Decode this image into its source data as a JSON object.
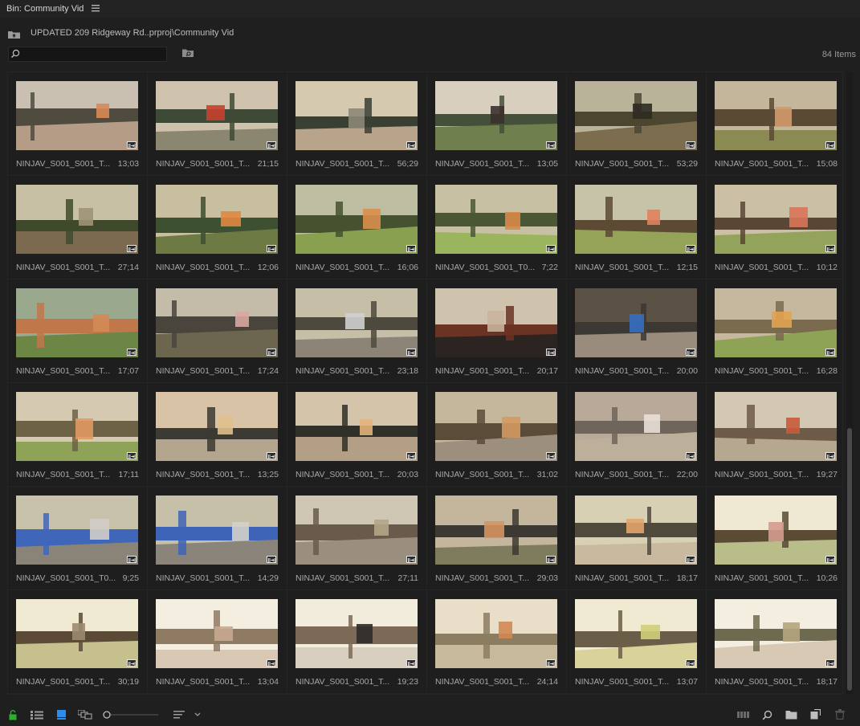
{
  "panel": {
    "title": "Bin: Community Vid"
  },
  "path": {
    "text": "UPDATED 209 Ridgeway Rd..prproj\\Community Vid"
  },
  "search": {
    "value": "",
    "placeholder": ""
  },
  "status": {
    "items_count": "84 Items"
  },
  "clips": [
    {
      "name": "NINJAV_S001_S001_T...",
      "duration": "13;03",
      "palette": {
        "sky": "#c9c0b2",
        "mid": "#4f4b3f",
        "ground": "#b59c86",
        "accent": "#d88a55"
      }
    },
    {
      "name": "NINJAV_S001_S001_T...",
      "duration": "21;15",
      "palette": {
        "sky": "#cfc2ad",
        "mid": "#3f4a36",
        "ground": "#8a8670",
        "accent": "#c7402c"
      }
    },
    {
      "name": "NINJAV_S001_S001_T...",
      "duration": "56;29",
      "palette": {
        "sky": "#d5c9b0",
        "mid": "#3a3f33",
        "ground": "#b8a48a",
        "accent": "#8d8777"
      }
    },
    {
      "name": "NINJAV_S001_S001_T...",
      "duration": "13;05",
      "palette": {
        "sky": "#d9cfbf",
        "mid": "#45503a",
        "ground": "#6f7f4d",
        "accent": "#3b302c"
      }
    },
    {
      "name": "NINJAV_S001_S001_T...",
      "duration": "53;29",
      "palette": {
        "sky": "#b9b39a",
        "mid": "#4c4631",
        "ground": "#7c6d4f",
        "accent": "#2e2a22"
      }
    },
    {
      "name": "NINJAV_S001_S001_T...",
      "duration": "15;08",
      "palette": {
        "sky": "#c4b69a",
        "mid": "#5a4a35",
        "ground": "#8c8a53",
        "accent": "#d39a6a"
      }
    },
    {
      "name": "NINJAV_S001_S001_T...",
      "duration": "27;14",
      "palette": {
        "sky": "#c7c0a4",
        "mid": "#3f4a2d",
        "ground": "#7c6a50",
        "accent": "#a09475"
      }
    },
    {
      "name": "NINJAV_S001_S001_T...",
      "duration": "12;06",
      "palette": {
        "sky": "#c8bea0",
        "mid": "#3d5030",
        "ground": "#6e7a44",
        "accent": "#e08840"
      }
    },
    {
      "name": "NINJAV_S001_S001_T...",
      "duration": "16;06",
      "palette": {
        "sky": "#bdbda2",
        "mid": "#45512f",
        "ground": "#88a050",
        "accent": "#d98f4c"
      }
    },
    {
      "name": "NINJAV_S001_S001_T0...",
      "duration": "7;22",
      "palette": {
        "sky": "#c8c0a2",
        "mid": "#4a5734",
        "ground": "#9bb55e",
        "accent": "#d78a48"
      }
    },
    {
      "name": "NINJAV_S001_S001_T...",
      "duration": "12;15",
      "palette": {
        "sky": "#c7c3a8",
        "mid": "#5c4a34",
        "ground": "#95a359",
        "accent": "#e0825e"
      }
    },
    {
      "name": "NINJAV_S001_S001_T...",
      "duration": "10;12",
      "palette": {
        "sky": "#cbbfa6",
        "mid": "#5a4634",
        "ground": "#93a35b",
        "accent": "#d9755a"
      }
    },
    {
      "name": "NINJAV_S001_S001_T...",
      "duration": "17;07",
      "palette": {
        "sky": "#9aa98d",
        "mid": "#c0784a",
        "ground": "#6c8646",
        "accent": "#d48a57"
      }
    },
    {
      "name": "NINJAV_S001_S001_T...",
      "duration": "17;24",
      "palette": {
        "sky": "#c4bca8",
        "mid": "#4a453c",
        "ground": "#6c664f",
        "accent": "#d8a6a0"
      }
    },
    {
      "name": "NINJAV_S001_S001_T...",
      "duration": "23;18",
      "palette": {
        "sky": "#c7bea8",
        "mid": "#4d4a3d",
        "ground": "#8c8476",
        "accent": "#cfcfcf"
      }
    },
    {
      "name": "NINJAV_S001_S001_T...",
      "duration": "20;17",
      "palette": {
        "sky": "#cfc3ae",
        "mid": "#6b3324",
        "ground": "#2b2420",
        "accent": "#c8b49e"
      }
    },
    {
      "name": "NINJAV_S001_S001_T...",
      "duration": "20;00",
      "palette": {
        "sky": "#5b5145",
        "mid": "#3c3833",
        "ground": "#9a8c7c",
        "accent": "#356ec1"
      }
    },
    {
      "name": "NINJAV_S001_S001_T...",
      "duration": "16;28",
      "palette": {
        "sky": "#c5b89f",
        "mid": "#7a6a4e",
        "ground": "#8fa356",
        "accent": "#e3a34f"
      }
    },
    {
      "name": "NINJAV_S001_S001_T...",
      "duration": "17;11",
      "palette": {
        "sky": "#d6c9b2",
        "mid": "#6d6246",
        "ground": "#8fa358",
        "accent": "#e09a60"
      }
    },
    {
      "name": "NINJAV_S001_S001_T...",
      "duration": "13;25",
      "palette": {
        "sky": "#d8c3a6",
        "mid": "#3b3a33",
        "ground": "#b3a58e",
        "accent": "#e0c08c"
      }
    },
    {
      "name": "NINJAV_S001_S001_T...",
      "duration": "20;03",
      "palette": {
        "sky": "#d3c4aa",
        "mid": "#2f3028",
        "ground": "#b39f85",
        "accent": "#e3b37a"
      }
    },
    {
      "name": "NINJAV_S001_S001_T...",
      "duration": "31;02",
      "palette": {
        "sky": "#c5b79c",
        "mid": "#5a4c38",
        "ground": "#9c8f7d",
        "accent": "#d39a60"
      }
    },
    {
      "name": "NINJAV_S001_S001_T...",
      "duration": "22;00",
      "palette": {
        "sky": "#b9a998",
        "mid": "#70655a",
        "ground": "#bdb09a",
        "accent": "#e9dfd6"
      }
    },
    {
      "name": "NINJAV_S001_S001_T...",
      "duration": "19;27",
      "palette": {
        "sky": "#d3c8b3",
        "mid": "#6d5b48",
        "ground": "#b5a790",
        "accent": "#c95a3c"
      }
    },
    {
      "name": "NINJAV_S001_S001_T0...",
      "duration": "9;25",
      "palette": {
        "sky": "#c9c2aa",
        "mid": "#3f66b8",
        "ground": "#8a8478",
        "accent": "#d2cec8"
      }
    },
    {
      "name": "NINJAV_S001_S001_T...",
      "duration": "14;29",
      "palette": {
        "sky": "#c7c0a8",
        "mid": "#3d64b6",
        "ground": "#8a847a",
        "accent": "#d4d0c9"
      }
    },
    {
      "name": "NINJAV_S001_S001_T...",
      "duration": "27;11",
      "palette": {
        "sky": "#cfc6b4",
        "mid": "#6a5a4c",
        "ground": "#9a8f7f",
        "accent": "#b4a587"
      }
    },
    {
      "name": "NINJAV_S001_S001_T...",
      "duration": "29;03",
      "palette": {
        "sky": "#c3b69c",
        "mid": "#3d3831",
        "ground": "#7f7b5d",
        "accent": "#d69462"
      }
    },
    {
      "name": "NINJAV_S001_S001_T...",
      "duration": "18;17",
      "palette": {
        "sky": "#d8d0b5",
        "mid": "#4f4a3c",
        "ground": "#c9b99e",
        "accent": "#e2a46c"
      }
    },
    {
      "name": "NINJAV_S001_S001_T...",
      "duration": "10;26",
      "palette": {
        "sky": "#efe8d3",
        "mid": "#5b4a34",
        "ground": "#b9bd8a",
        "accent": "#d59b8f"
      }
    },
    {
      "name": "NINJAV_S001_S001_T...",
      "duration": "30;19",
      "palette": {
        "sky": "#f0ead3",
        "mid": "#5a4a36",
        "ground": "#c6bf8e",
        "accent": "#9c8b6f"
      }
    },
    {
      "name": "NINJAV_S001_S001_T...",
      "duration": "13;04",
      "palette": {
        "sky": "#f4eee0",
        "mid": "#8f7a63",
        "ground": "#d8c8b4",
        "accent": "#c7a88e"
      }
    },
    {
      "name": "NINJAV_S001_S001_T...",
      "duration": "19;23",
      "palette": {
        "sky": "#f2ecdc",
        "mid": "#7d6a56",
        "ground": "#d9cfc0",
        "accent": "#2e2b28"
      }
    },
    {
      "name": "NINJAV_S001_S001_T...",
      "duration": "24;14",
      "palette": {
        "sky": "#e9dec7",
        "mid": "#8c7c60",
        "ground": "#c7b99c",
        "accent": "#d18752"
      }
    },
    {
      "name": "NINJAV_S001_S001_T...",
      "duration": "13;07",
      "palette": {
        "sky": "#f0ead2",
        "mid": "#6b5e48",
        "ground": "#d9d29a",
        "accent": "#cfcf7a"
      }
    },
    {
      "name": "NINJAV_S001_S001_T...",
      "duration": "18;17",
      "palette": {
        "sky": "#f3eedf",
        "mid": "#6e6a4f",
        "ground": "#d8c9b4",
        "accent": "#b4a57e"
      }
    }
  ],
  "colors": {
    "background": "#1f1f1f",
    "lock_icon": "#2bb02b",
    "view_icon_active": "#2d8ceb"
  },
  "icons": {
    "menu": "hamburger-icon",
    "up": "folder-up-icon",
    "search": "search-icon",
    "find": "find-folder-icon",
    "lock": "lock-icon",
    "list_view": "list-view-icon",
    "icon_view": "icon-view-icon",
    "freeform": "freeform-view-icon",
    "zoom": "zoom-slider",
    "sort": "sort-icon",
    "automate": "automate-to-sequence-icon",
    "find_bottom": "find-icon",
    "new_bin": "new-bin-icon",
    "new_item": "new-item-icon",
    "clear": "trash-icon",
    "clip_badge": "video-clip-badge"
  }
}
